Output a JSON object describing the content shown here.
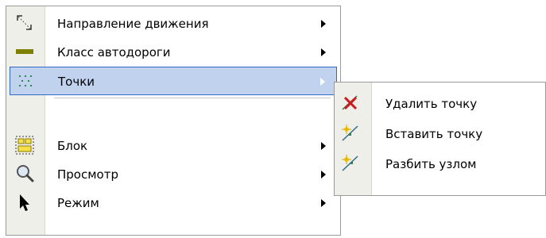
{
  "menu": {
    "items": [
      {
        "label": "Направление движения",
        "icon": "direction-arrow-icon",
        "has_submenu": true
      },
      {
        "label": "Класс автодороги",
        "icon": "road-class-icon",
        "has_submenu": true
      },
      {
        "label": "Точки",
        "icon": "points-icon",
        "has_submenu": true,
        "selected": true
      },
      {
        "label": "Блок",
        "icon": "block-icon",
        "has_submenu": true
      },
      {
        "label": "Просмотр",
        "icon": "magnifier-icon",
        "has_submenu": true
      },
      {
        "label": "Режим",
        "icon": "cursor-arrow-icon",
        "has_submenu": true
      }
    ]
  },
  "submenu": {
    "items": [
      {
        "label": "Удалить точку",
        "icon": "delete-point-icon"
      },
      {
        "label": "Вставить точку",
        "icon": "insert-point-icon"
      },
      {
        "label": "Разбить узлом",
        "icon": "split-node-icon"
      }
    ]
  },
  "colors": {
    "highlight_fill": "#c1d2ee",
    "highlight_border": "#316ac5",
    "gutter": "#efefe9",
    "road_class": "#808000"
  }
}
